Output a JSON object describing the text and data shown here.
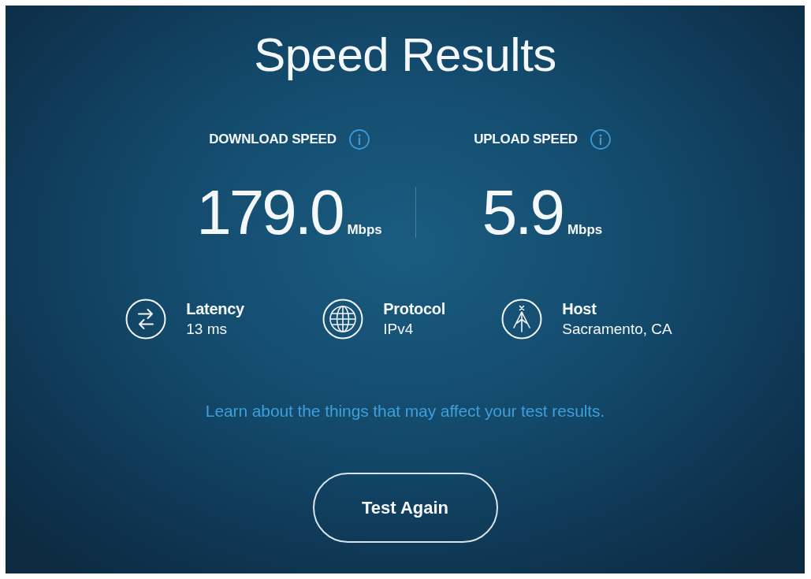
{
  "title": "Speed Results",
  "speeds": [
    {
      "label": "DOWNLOAD SPEED",
      "value": "179.0",
      "unit": "Mbps"
    },
    {
      "label": "UPLOAD SPEED",
      "value": "5.9",
      "unit": "Mbps"
    }
  ],
  "details": [
    {
      "kind": "latency",
      "label": "Latency",
      "value": "13 ms"
    },
    {
      "kind": "protocol",
      "label": "Protocol",
      "value": "IPv4"
    },
    {
      "kind": "host",
      "label": "Host",
      "value": "Sacramento, CA"
    }
  ],
  "link": "Learn about the things that may affect your test results.",
  "button": "Test Again"
}
